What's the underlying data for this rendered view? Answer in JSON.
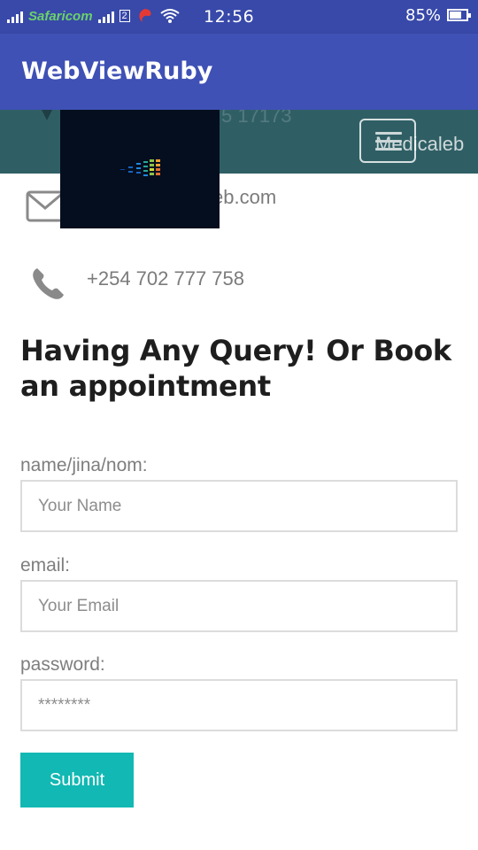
{
  "status_bar": {
    "carrier": "Safaricom",
    "sim_label": "2",
    "time": "12:56",
    "battery": "85%",
    "battery_level": 0.85
  },
  "app_bar": {
    "title": "WebViewRuby"
  },
  "site_header": {
    "brand": "Medicaleb",
    "partial_phone": "5 17173"
  },
  "contacts": {
    "email_partial": "eb.com",
    "phone": "+254 702 777 758"
  },
  "form": {
    "heading": "Having Any Query! Or Book an appointment",
    "name_label": "name/jina/nom:",
    "name_placeholder": "Your Name",
    "email_label": "email:",
    "email_placeholder": "Your Email",
    "password_label": "password:",
    "password_placeholder": "********",
    "submit_label": "Submit"
  },
  "colors": {
    "status_bar": "#3849a9",
    "app_bar": "#3f51b5",
    "site_header": "#2f5f65",
    "submit": "#12b8b3"
  }
}
